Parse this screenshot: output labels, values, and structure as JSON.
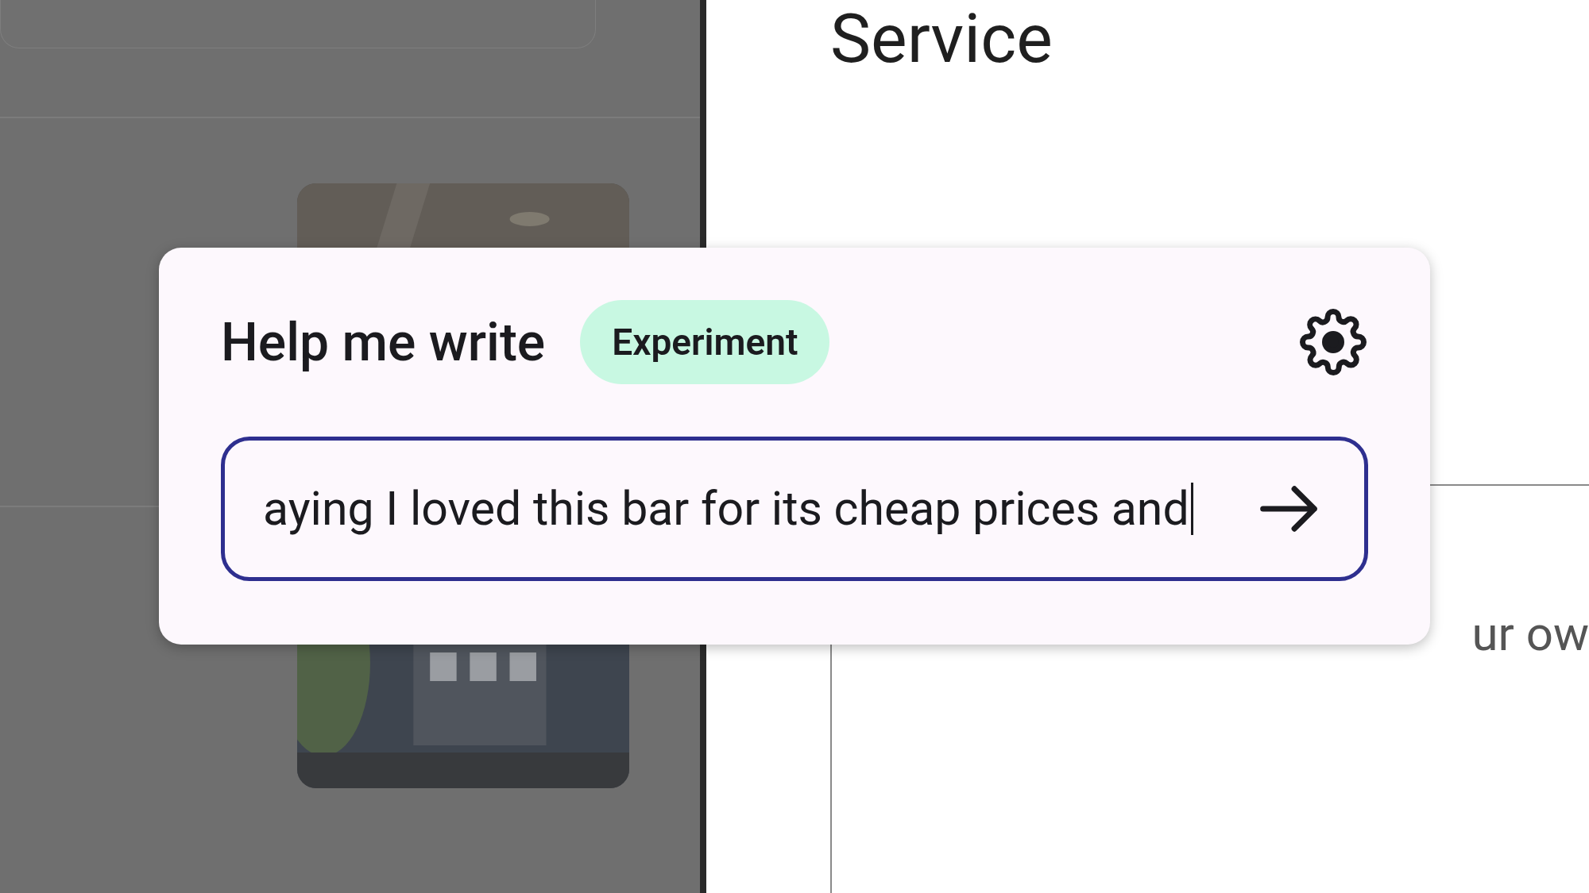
{
  "review": {
    "section_title": "Service",
    "text_area": {
      "partial_text": "ur ow"
    }
  },
  "dialog": {
    "title": "Help me write",
    "badge": "Experiment",
    "prompt_field": {
      "value": "aying I loved this bar for its cheap prices and"
    }
  }
}
